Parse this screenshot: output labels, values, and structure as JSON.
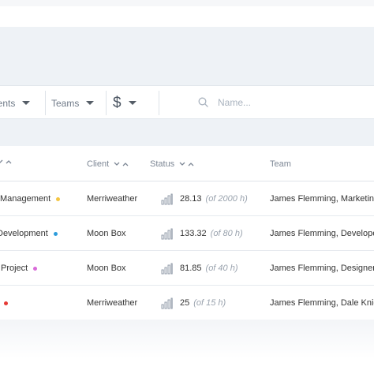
{
  "filters": {
    "clients_label": "ients",
    "teams_label": "Teams",
    "currency_label": "$"
  },
  "search": {
    "placeholder": "Name..."
  },
  "table": {
    "columns": {
      "project": "",
      "client": "Client",
      "status": "Status",
      "team": "Team"
    },
    "rows": [
      {
        "project": "Management",
        "dot_color": "#f4c542",
        "client": "Merriweather",
        "hours": "28.13",
        "budget": "(of 2000 h)",
        "team": "James Flemming, Marketing"
      },
      {
        "project": "Development",
        "dot_color": "#2d9cdb",
        "client": "Moon Box",
        "hours": "133.32",
        "budget": "(of 80 h)",
        "team": "James Flemming, Developer"
      },
      {
        "project": "Project",
        "dot_color": "#d96ad9",
        "client": "Moon Box",
        "hours": "81.85",
        "budget": "(of 40 h)",
        "team": "James Flemming, Designers"
      },
      {
        "project": "",
        "dot_color": "#e53935",
        "client": "Merriweather",
        "hours": "25",
        "budget": "(of 15 h)",
        "team": "James Flemming, Dale Knight"
      }
    ]
  }
}
